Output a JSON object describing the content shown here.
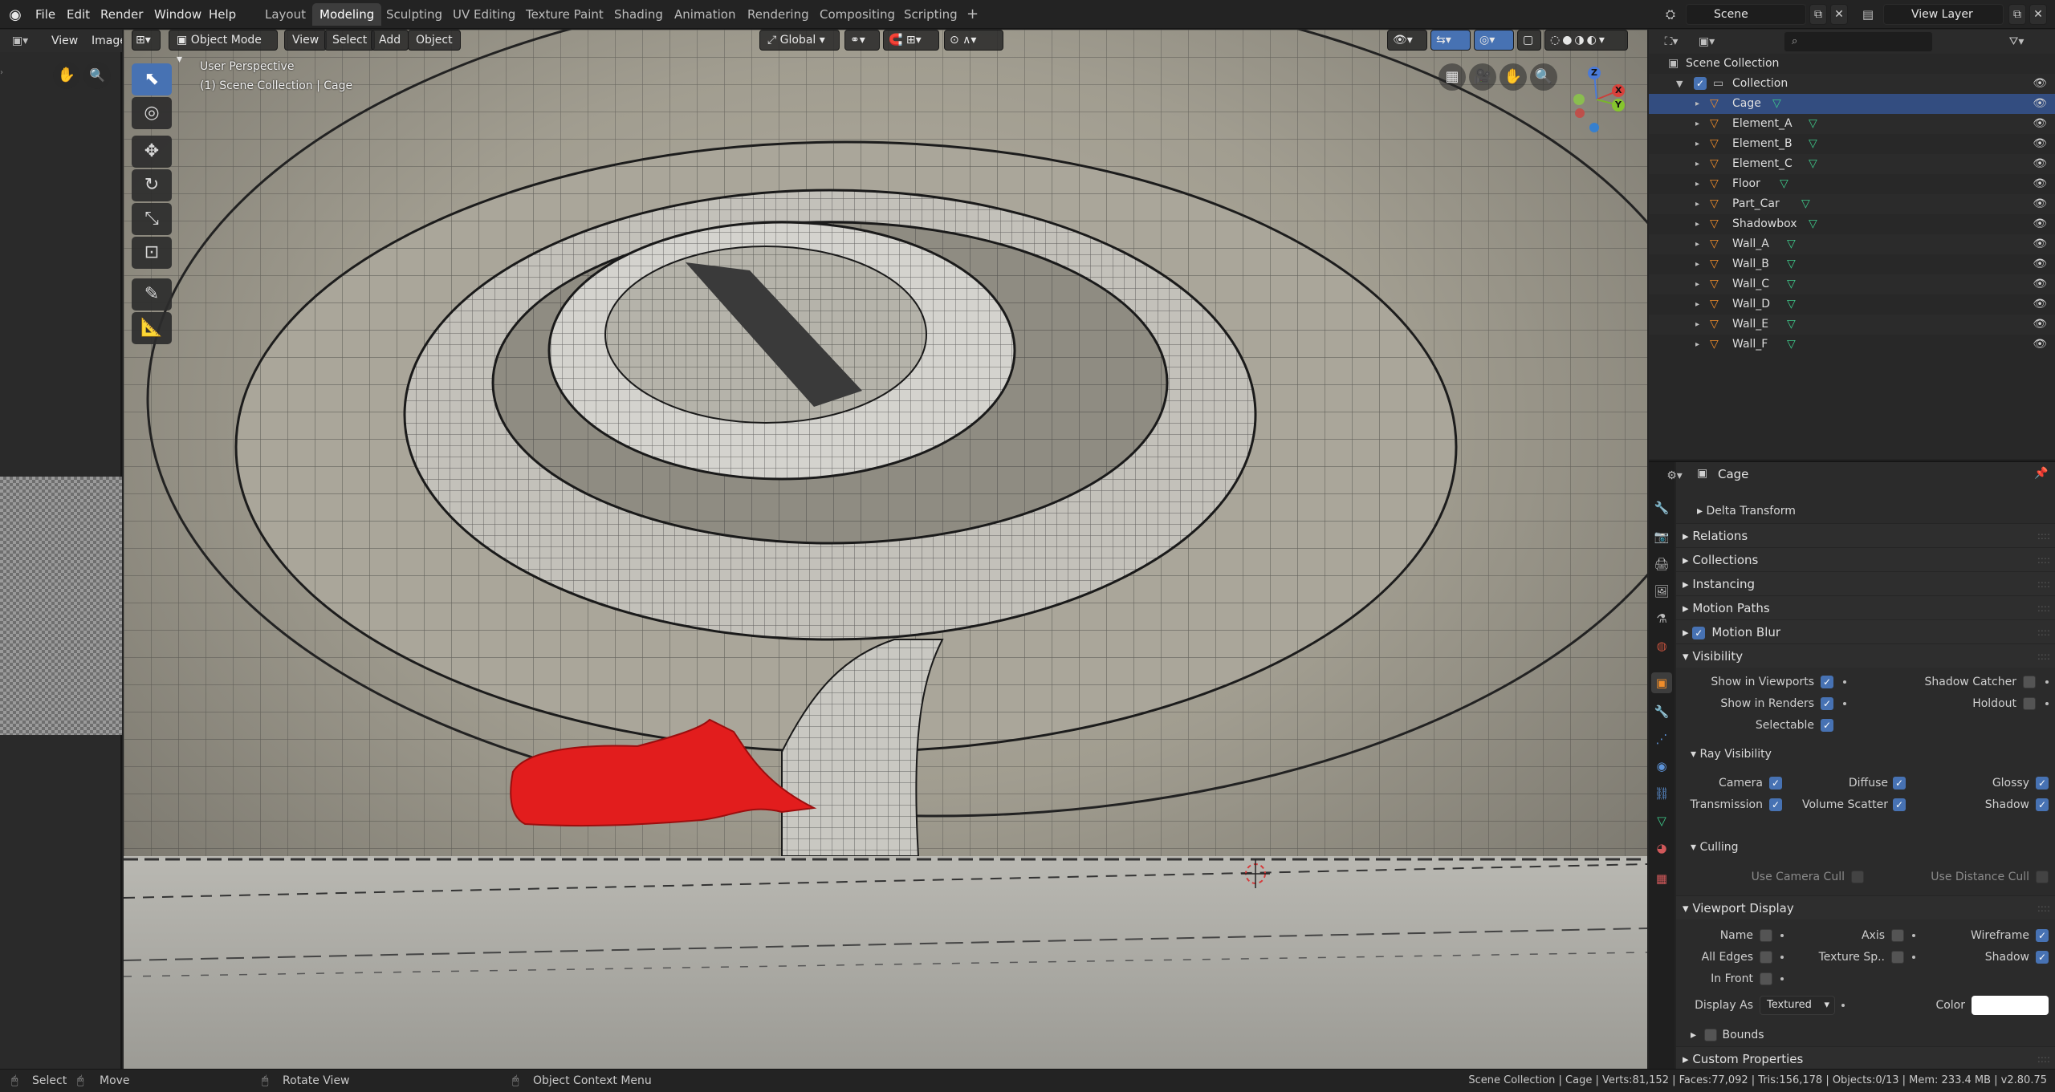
{
  "topbar": {
    "menus": [
      "File",
      "Edit",
      "Render",
      "Window",
      "Help"
    ],
    "workspaces": [
      "Layout",
      "Modeling",
      "Sculpting",
      "UV Editing",
      "Texture Paint",
      "Shading",
      "Animation",
      "Rendering",
      "Compositing",
      "Scripting"
    ],
    "active_workspace": "Modeling",
    "add_workspace": "+",
    "scene_name": "Scene",
    "view_layer_name": "View Layer"
  },
  "image_editor": {
    "view_menu": "View",
    "image_menu": "Image"
  },
  "viewport": {
    "mode": "Object Mode",
    "menus": [
      "View",
      "Select",
      "Add",
      "Object"
    ],
    "transform_orientation": "Global",
    "overlay_line1": "User Perspective",
    "overlay_line2": "(1) Scene Collection | Cage",
    "gizmo_labels": {
      "z": "Z",
      "y": "Y",
      "x": "X"
    }
  },
  "outliner": {
    "search_placeholder": "",
    "scene_collection": "Scene Collection",
    "collection": "Collection",
    "objects": [
      "Cage",
      "Element_A",
      "Element_B",
      "Element_C",
      "Floor",
      "Part_Car",
      "Shadowbox",
      "Wall_A",
      "Wall_B",
      "Wall_C",
      "Wall_D",
      "Wall_E",
      "Wall_F"
    ]
  },
  "properties": {
    "object_name": "Cage",
    "delta_transform": "Delta Transform",
    "relations": "Relations",
    "collections": "Collections",
    "instancing": "Instancing",
    "motion_paths": "Motion Paths",
    "motion_blur": "Motion Blur",
    "visibility": "Visibility",
    "show_in_viewports": "Show in Viewports",
    "show_in_renders": "Show in Renders",
    "selectable": "Selectable",
    "shadow_catcher": "Shadow Catcher",
    "holdout": "Holdout",
    "ray_visibility": "Ray Visibility",
    "camera": "Camera",
    "diffuse": "Diffuse",
    "glossy": "Glossy",
    "transmission": "Transmission",
    "volume_scatter": "Volume Scatter",
    "shadow": "Shadow",
    "culling": "Culling",
    "use_camera_cull": "Use Camera Cull",
    "use_distance_cull": "Use Distance Cull",
    "viewport_display": "Viewport Display",
    "name": "Name",
    "axis": "Axis",
    "wireframe": "Wireframe",
    "all_edges": "All Edges",
    "texture_space": "Texture Sp..",
    "display_shadow": "Shadow",
    "in_front": "In Front",
    "display_as": "Display As",
    "display_as_value": "Textured",
    "color": "Color",
    "color_value": "#ffffff",
    "bounds": "Bounds",
    "custom_properties": "Custom Properties"
  },
  "statusbar": {
    "select": "Select",
    "move": "Move",
    "rotate_view": "Rotate View",
    "context_menu": "Object Context Menu",
    "stats": "Scene Collection | Cage | Verts:81,152 | Faces:77,092 | Tris:156,178 | Objects:0/13 | Mem: 233.4 MB | v2.80.75"
  }
}
